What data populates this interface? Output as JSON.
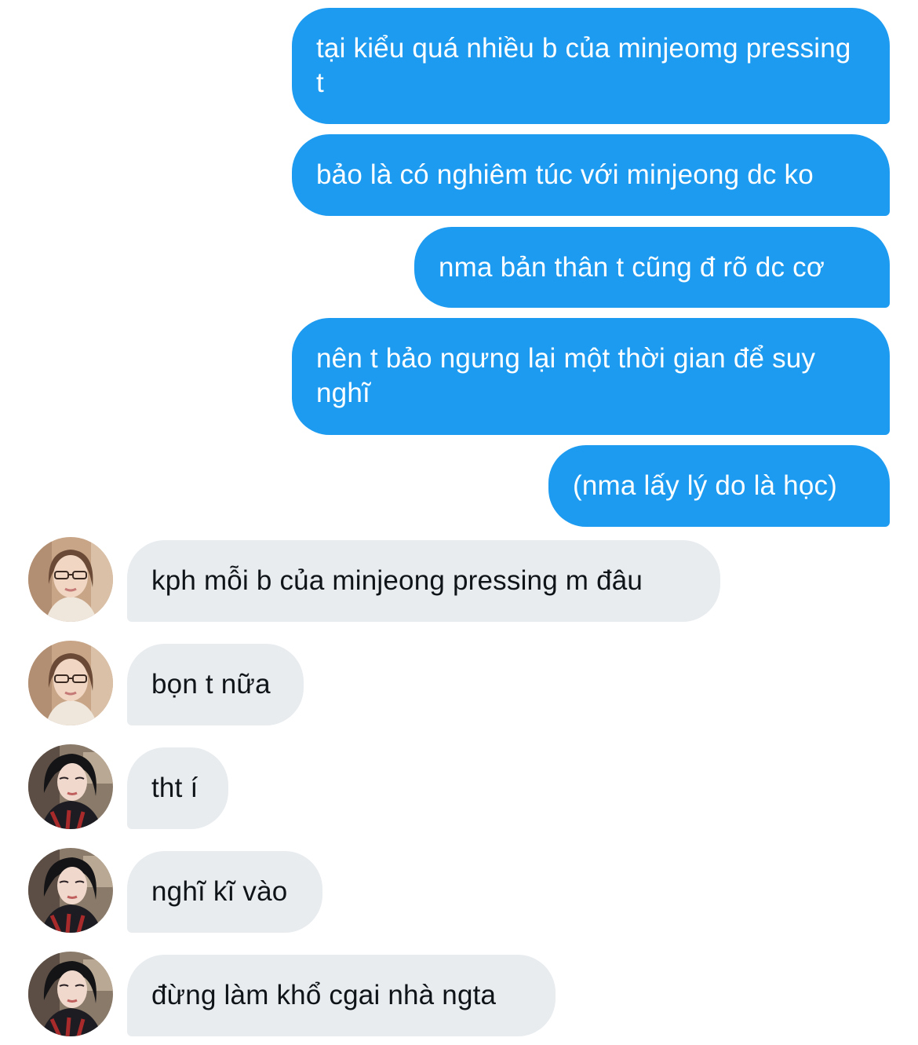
{
  "conversation": {
    "messages": [
      {
        "sender": "me",
        "text": "tại kiểu quá nhiều b của minjeomg pressing t"
      },
      {
        "sender": "me",
        "text": "bảo là có nghiêm túc với minjeong dc ko"
      },
      {
        "sender": "me",
        "text": "nma bản thân t cũng đ rõ dc cơ"
      },
      {
        "sender": "me",
        "text": "nên t bảo ngưng lại một thời gian để suy nghĩ"
      },
      {
        "sender": "me",
        "text": "(nma lấy lý do là học)"
      },
      {
        "sender": "contact-1",
        "text": "kph mỗi b của minjeong pressing m đâu"
      },
      {
        "sender": "contact-1",
        "text": "bọn t nữa"
      },
      {
        "sender": "contact-2",
        "text": "tht í"
      },
      {
        "sender": "contact-2",
        "text": "nghĩ kĩ vào"
      },
      {
        "sender": "contact-2",
        "text": "đừng làm khổ cgai nhà ngta"
      }
    ]
  },
  "colors": {
    "outgoing_bubble": "#1d9bf0",
    "outgoing_text": "#ffffff",
    "incoming_bubble": "#e8ecef",
    "incoming_text": "#0f1419",
    "background": "#ffffff"
  },
  "icons": {
    "contact_1_avatar": "avatar-photo-woman-with-glasses",
    "contact_2_avatar": "avatar-photo-woman-short-dark-hair"
  }
}
